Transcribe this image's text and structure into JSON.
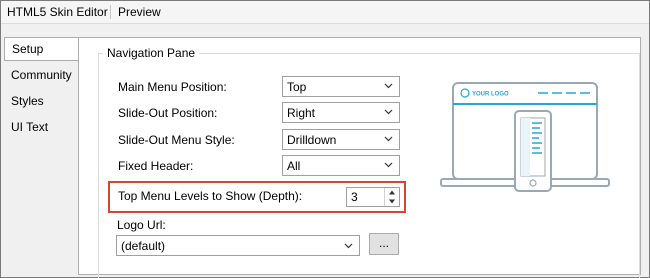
{
  "title_bar": {
    "tabs": [
      "HTML5 Skin Editor",
      "Preview"
    ]
  },
  "left_nav": {
    "items": [
      "Setup",
      "Community",
      "Styles",
      "UI Text"
    ],
    "active": "Setup"
  },
  "navigation_pane": {
    "legend": "Navigation Pane",
    "main_menu_position": {
      "label": "Main Menu Position:",
      "value": "Top"
    },
    "slide_out_position": {
      "label": "Slide-Out Position:",
      "value": "Right"
    },
    "slide_out_menu_style": {
      "label": "Slide-Out Menu Style:",
      "value": "Drilldown"
    },
    "fixed_header": {
      "label": "Fixed Header:",
      "value": "All"
    },
    "top_menu_levels": {
      "label": "Top Menu Levels to Show (Depth):",
      "value": "3"
    },
    "logo_url": {
      "label": "Logo Url:",
      "value": "(default)",
      "browse_label": "..."
    }
  },
  "illustration": {
    "logo_text": "YOUR LOGO"
  },
  "colors": {
    "highlight_border": "#d4472a",
    "illustration_blue": "#29a6d6"
  }
}
